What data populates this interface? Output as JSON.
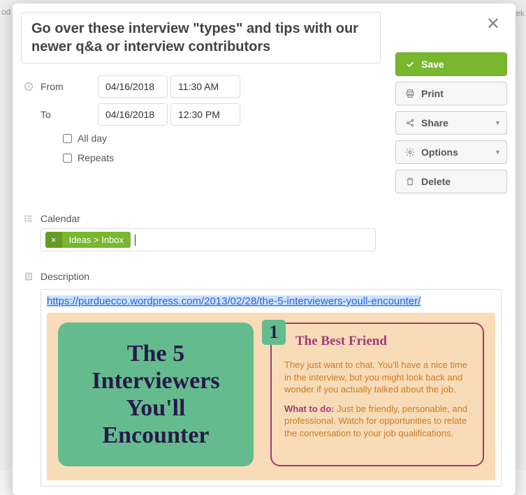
{
  "title": "Go over these interview \"types\" and tips with our newer q&a or interview contributors",
  "from_label": "From",
  "to_label": "To",
  "from_date": "04/16/2018",
  "from_time": "11:30 AM",
  "to_date": "04/16/2018",
  "to_time": "12:30 PM",
  "all_day_label": "All day",
  "repeats_label": "Repeats",
  "calendar_label": "Calendar",
  "calendar_tag": "Ideas > Inbox",
  "description_label": "Description",
  "description_link": "https://purduecco.wordpress.com/2013/02/28/the-5-interviewers-youll-encounter/",
  "actions": {
    "save": "Save",
    "print": "Print",
    "share": "Share",
    "options": "Options",
    "delete": "Delete"
  },
  "infographic": {
    "left_title": "The 5 Interviewers You'll Encounter",
    "badge": "1",
    "heading": "The Best Friend",
    "body1": "They just want to chat. You'll have a nice time in the interview, but you might look back and wonder if you actually talked about the job.",
    "body2_lead": "What to do:",
    "body2": " Just be friendly, personable, and professional. Watch for opportunities to relate the conversation to your job qualifications."
  },
  "bg": {
    "left": "od",
    "right": "eek"
  }
}
